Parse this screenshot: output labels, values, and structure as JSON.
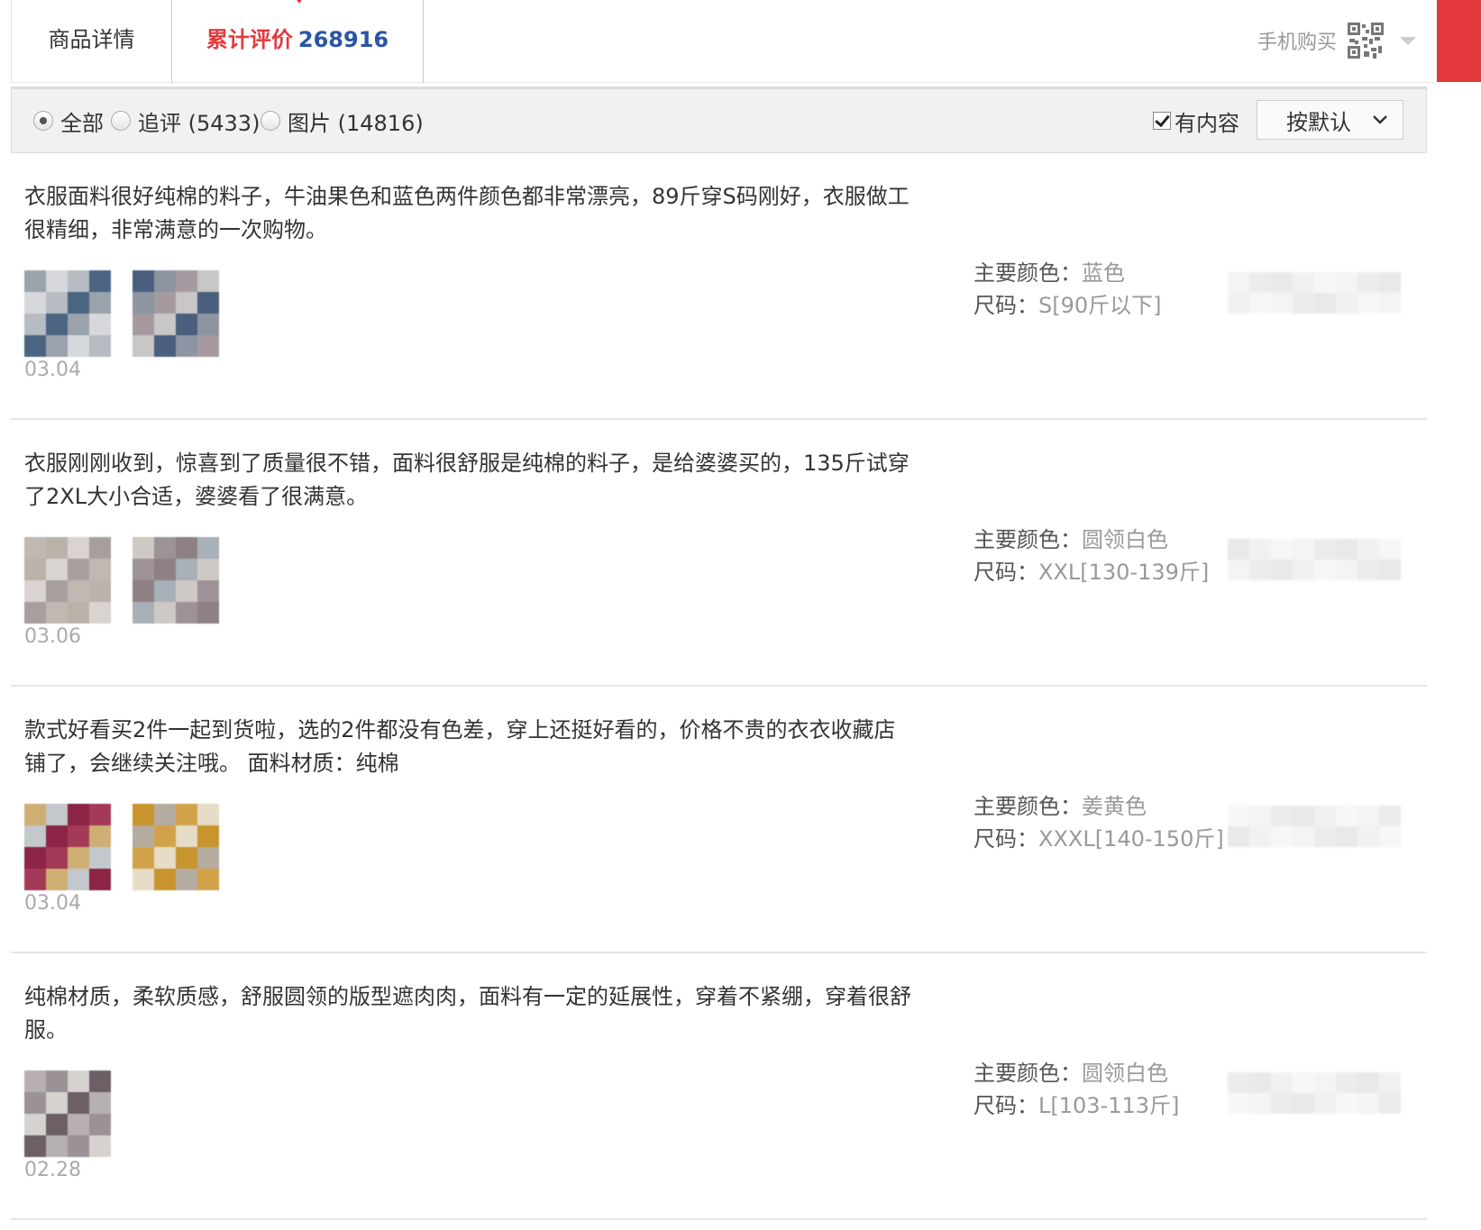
{
  "tabs": {
    "detail_label": "商品详情",
    "reviews_label": "累计评价",
    "reviews_count": "268916",
    "mobile_buy_label": "手机购买"
  },
  "filter": {
    "options": [
      {
        "label": "全部",
        "checked": true
      },
      {
        "label": "追评 (5433)",
        "checked": false
      },
      {
        "label": "图片 (14816)",
        "checked": false
      }
    ],
    "has_content_label": "有内容",
    "has_content_checked": true,
    "sort_label": "按默认"
  },
  "reviews": [
    {
      "text": "衣服面料很好纯棉的料子，牛油果色和蓝色两件颜色都非常漂亮，89斤穿S码刚好，衣服做工很精细，非常满意的一次购物。",
      "date": "03.04",
      "color_label": "主要颜色：",
      "color_value": "蓝色",
      "size_label": "尺码：",
      "size_value": "S[90斤以下]",
      "photo_palettes": [
        [
          "#9aa3ab",
          "#4b6482",
          "#b7bcc3",
          "#d6d8dc"
        ],
        [
          "#8e95a2",
          "#4a5f7d",
          "#c9c6c7",
          "#a49aa0"
        ]
      ]
    },
    {
      "text": "衣服刚刚收到，惊喜到了质量很不错，面料很舒服是纯棉的料子，是给婆婆买的，135斤试穿了2XL大小合适，婆婆看了很满意。",
      "date": "03.06",
      "color_label": "主要颜色：",
      "color_value": "圆领白色",
      "size_label": "尺码：",
      "size_value": "XXL[130-139斤]",
      "photo_palettes": [
        [
          "#c2b8b2",
          "#a89e9e",
          "#d9d4d0",
          "#b9b3a9"
        ],
        [
          "#9d9396",
          "#cfc9c6",
          "#a7b1b7",
          "#8f8183"
        ]
      ]
    },
    {
      "text": "款式好看买2件一起到货啦，选的2件都没有色差，穿上还挺好看的，价格不贵的衣衣收藏店铺了，会继续关注哦。 面料材质：纯棉",
      "date": "03.04",
      "color_label": "主要颜色：",
      "color_value": "姜黄色",
      "size_label": "尺码：",
      "size_value": "XXXL[140-150斤]",
      "photo_palettes": [
        [
          "#cfae73",
          "#a33a57",
          "#8b2445",
          "#c3c8cc"
        ],
        [
          "#b4ad9f",
          "#c8942e",
          "#e7dcc7",
          "#d2a24a"
        ]
      ]
    },
    {
      "text": "纯棉材质，柔软质感，舒服圆领的版型遮肉肉，面料有一定的延展性，穿着不紧绷，穿着很舒服。",
      "date": "02.28",
      "color_label": "主要颜色：",
      "color_value": "圆领白色",
      "size_label": "尺码：",
      "size_value": "L[103-113斤]",
      "photo_palettes": [
        [
          "#b7b0b3",
          "#6d5f66",
          "#d6d2cf",
          "#9c9197"
        ]
      ]
    }
  ],
  "colors": {
    "accent_red": "#e4393c",
    "count_blue": "#2a55a5"
  },
  "icons": [
    "qr-code-icon",
    "dropdown-triangle-icon",
    "chevron-down-icon"
  ]
}
